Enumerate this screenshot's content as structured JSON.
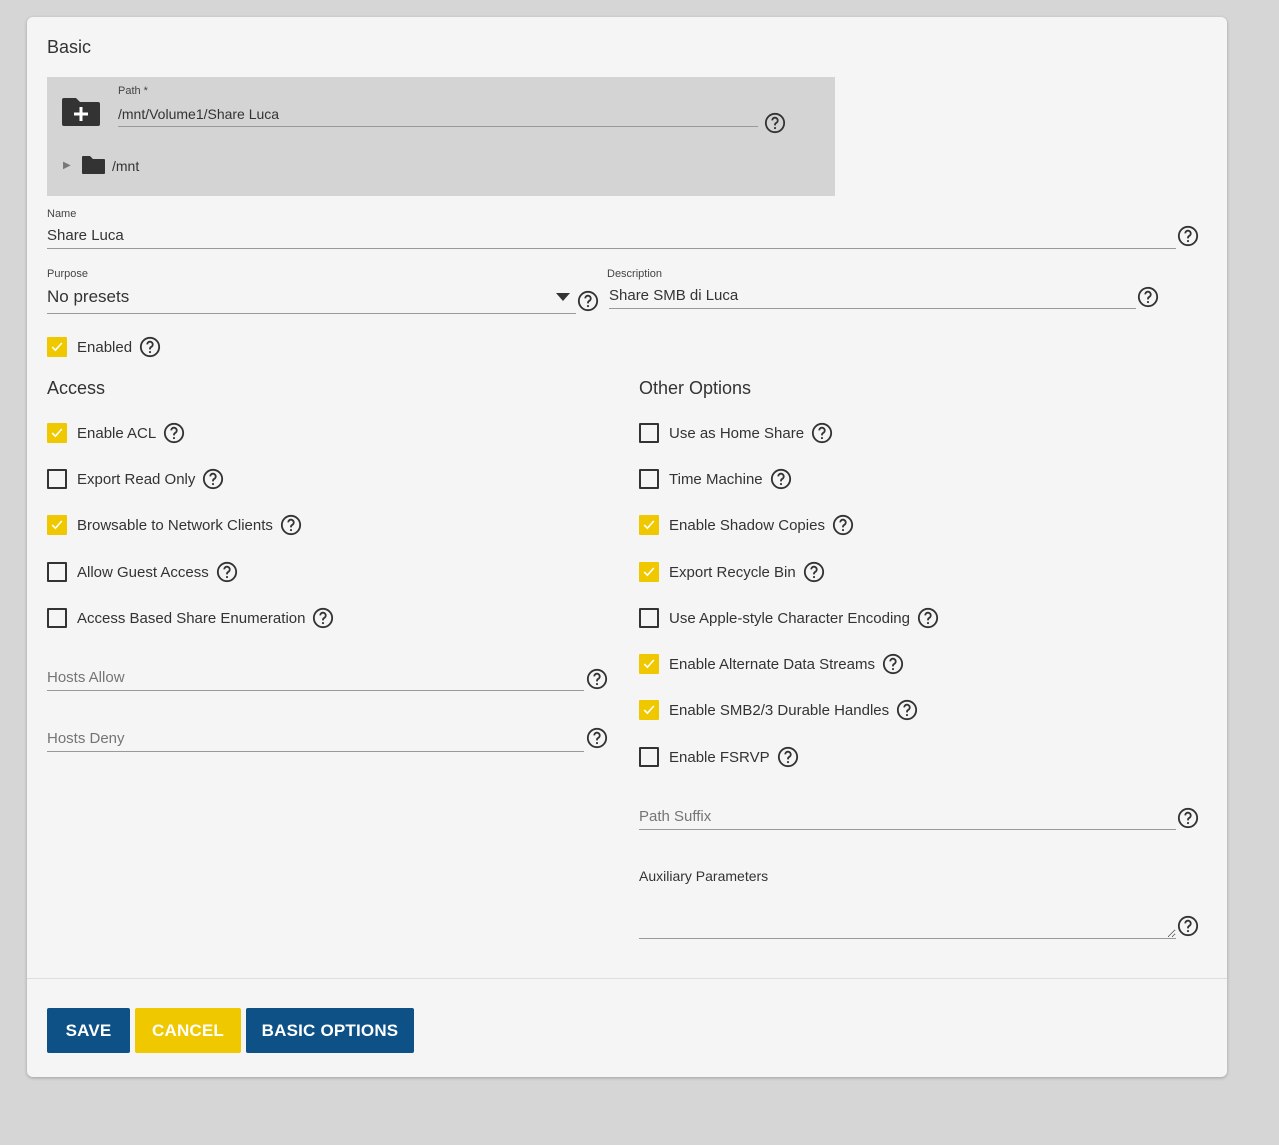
{
  "colors": {
    "accent_yellow": "#f0c800",
    "primary_blue": "#0d5187",
    "card_bg": "#f5f5f5",
    "page_bg": "#d6d6d6"
  },
  "basic": {
    "title": "Basic",
    "path": {
      "label": "Path *",
      "value": "/mnt/Volume1/Share Luca"
    },
    "tree": {
      "root_label": "/mnt"
    },
    "name": {
      "label": "Name",
      "value": "Share Luca"
    },
    "purpose": {
      "label": "Purpose",
      "value": "No presets"
    },
    "description": {
      "label": "Description",
      "value": "Share SMB di Luca"
    },
    "enabled": {
      "label": "Enabled",
      "checked": true
    }
  },
  "access": {
    "title": "Access",
    "options": [
      {
        "label": "Enable ACL",
        "checked": true
      },
      {
        "label": "Export Read Only",
        "checked": false
      },
      {
        "label": "Browsable to Network Clients",
        "checked": true
      },
      {
        "label": "Allow Guest Access",
        "checked": false
      },
      {
        "label": "Access Based Share Enumeration",
        "checked": false
      }
    ],
    "hosts_allow": {
      "placeholder": "Hosts Allow"
    },
    "hosts_deny": {
      "placeholder": "Hosts Deny"
    }
  },
  "other": {
    "title": "Other Options",
    "options": [
      {
        "label": "Use as Home Share",
        "checked": false
      },
      {
        "label": "Time Machine",
        "checked": false
      },
      {
        "label": "Enable Shadow Copies",
        "checked": true
      },
      {
        "label": "Export Recycle Bin",
        "checked": true
      },
      {
        "label": "Use Apple-style Character Encoding",
        "checked": false
      },
      {
        "label": "Enable Alternate Data Streams",
        "checked": true
      },
      {
        "label": "Enable SMB2/3 Durable Handles",
        "checked": true
      },
      {
        "label": "Enable FSRVP",
        "checked": false
      }
    ],
    "path_suffix": {
      "placeholder": "Path Suffix"
    },
    "aux_params": {
      "label": "Auxiliary Parameters"
    }
  },
  "actions": {
    "save": "SAVE",
    "cancel": "CANCEL",
    "basic_options": "BASIC OPTIONS"
  },
  "icons": {
    "help": "help-circle-icon",
    "folder_add": "folder-plus-icon",
    "folder": "folder-icon",
    "check": "check-icon"
  }
}
